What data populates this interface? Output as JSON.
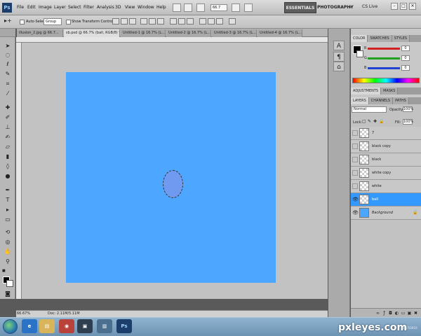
{
  "app": {
    "logo": "Ps",
    "menu": [
      "File",
      "Edit",
      "Image",
      "Layer",
      "Select",
      "Filter",
      "Analysis",
      "3D",
      "View",
      "Window",
      "Help"
    ],
    "zoom_value": "66.7",
    "workspaces": [
      "ESSENTIALS",
      "PHOTOGRAPHY",
      "»"
    ],
    "cs_live": "CS Live",
    "window_controls": [
      "–",
      "□",
      "✕"
    ]
  },
  "options": {
    "auto_select_label": "Auto-Select:",
    "auto_select_value": "Group",
    "transform_label": "Show Transform Controls"
  },
  "tabs": [
    "illusion_2.jpg @ 66.7...",
    "sb.psd @ 66.7% (ball, RGB/8) *",
    "Untitled-1 @ 16.7% (L...",
    "Untitled-2 @ 16.7% (L...",
    "Untitled-3 @ 16.7% (L...",
    "Untitled-4 @ 16.7% (L..."
  ],
  "status": {
    "zoom": "66.67%",
    "doc": "Doc: 2.11M/5.11M"
  },
  "panels": {
    "color_tabs": [
      "COLOR",
      "SWATCHES",
      "STYLES"
    ],
    "sliders": [
      {
        "label": "R",
        "value": "0",
        "color": "#d02020"
      },
      {
        "label": "G",
        "value": "0",
        "color": "#20a020"
      },
      {
        "label": "B",
        "value": "0",
        "color": "#2040d0"
      }
    ],
    "adjust_tabs": [
      "ADJUSTMENTS",
      "MASKS"
    ],
    "layers_tabs": [
      "LAYERS",
      "CHANNELS",
      "PATHS"
    ],
    "blend_mode": "Normal",
    "opacity_label": "Opacity:",
    "opacity_value": "100%",
    "lock_label": "Lock:",
    "fill_label": "Fill:",
    "fill_value": "100%"
  },
  "layers": [
    {
      "name": "7",
      "visible": false,
      "active": false,
      "thumb": "transparent"
    },
    {
      "name": "black copy",
      "visible": false,
      "active": false,
      "thumb": "transparent"
    },
    {
      "name": "black",
      "visible": false,
      "active": false,
      "thumb": "transparent"
    },
    {
      "name": "white copy",
      "visible": false,
      "active": false,
      "thumb": "transparent"
    },
    {
      "name": "white",
      "visible": false,
      "active": false,
      "thumb": "transparent"
    },
    {
      "name": "ball",
      "visible": true,
      "active": true,
      "thumb": "transparent"
    },
    {
      "name": "Background",
      "visible": true,
      "active": false,
      "thumb": "blue",
      "locked": true
    }
  ],
  "colors": {
    "document": "#4da6ff",
    "ball": "#6f9af0",
    "active_layer": "#3399ff"
  },
  "taskbar": {
    "apps": [
      "e",
      "▤",
      "◉",
      "▣",
      "▥",
      "Ps"
    ],
    "watermark": "pxleyes.com",
    "clock": "10/7/2010"
  }
}
